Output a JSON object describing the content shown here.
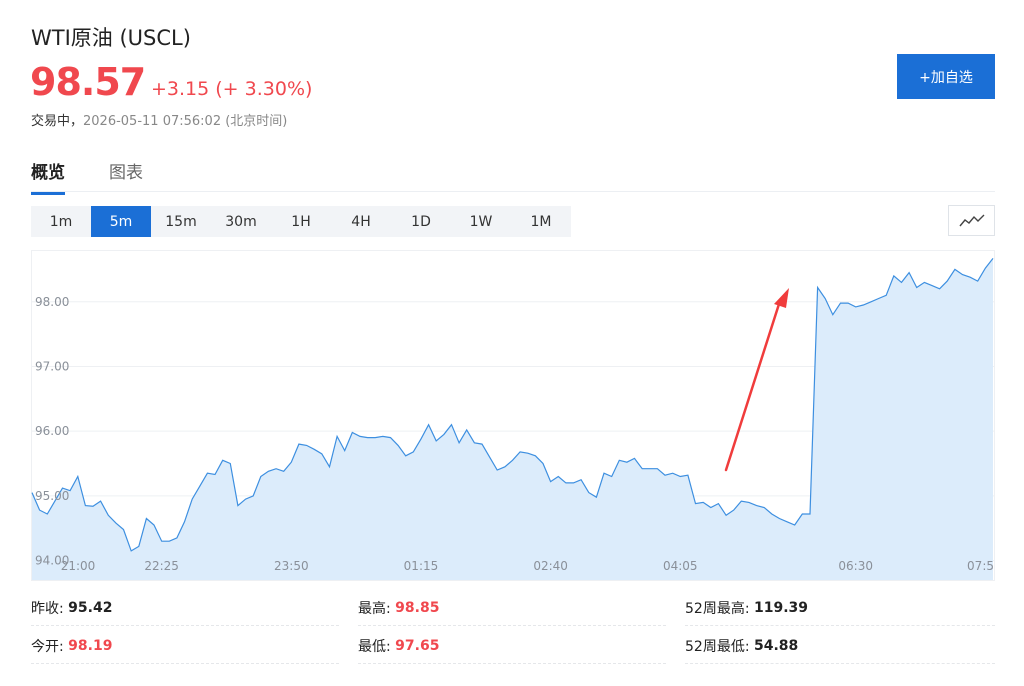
{
  "header": {
    "title": "WTI原油 (USCL)",
    "price": "98.57",
    "change": "+3.15 (+ 3.30%)",
    "status_prefix": "交易中，",
    "timestamp": "2026-05-11 07:56:02 (北京时间)",
    "add_button": "+加自选"
  },
  "tabs": [
    {
      "label": "概览",
      "active": true
    },
    {
      "label": "图表",
      "active": false
    }
  ],
  "ranges": [
    {
      "label": "1m",
      "active": false
    },
    {
      "label": "5m",
      "active": true
    },
    {
      "label": "15m",
      "active": false
    },
    {
      "label": "30m",
      "active": false
    },
    {
      "label": "1H",
      "active": false
    },
    {
      "label": "4H",
      "active": false
    },
    {
      "label": "1D",
      "active": false
    },
    {
      "label": "1W",
      "active": false
    },
    {
      "label": "1M",
      "active": false
    }
  ],
  "chart_data": {
    "type": "area",
    "ylim": [
      93.7,
      98.8
    ],
    "yticks": [
      94.0,
      95.0,
      96.0,
      97.0,
      98.0
    ],
    "ytick_labels": [
      "94.00",
      "95.00",
      "96.00",
      "97.00",
      "98.00"
    ],
    "xtick_labels": [
      "21:00",
      "22:25",
      "23:50",
      "01:15",
      "02:40",
      "04:05",
      "06:30",
      "07:5"
    ],
    "xtick_positions": [
      0,
      17,
      34,
      51,
      68,
      85,
      108,
      123
    ],
    "values": [
      95.05,
      94.78,
      94.72,
      94.92,
      95.12,
      95.08,
      95.3,
      94.85,
      94.84,
      94.92,
      94.7,
      94.58,
      94.48,
      94.15,
      94.22,
      94.65,
      94.55,
      94.3,
      94.3,
      94.35,
      94.6,
      94.95,
      95.15,
      95.35,
      95.33,
      95.55,
      95.5,
      94.85,
      94.95,
      95.0,
      95.3,
      95.38,
      95.42,
      95.38,
      95.52,
      95.8,
      95.78,
      95.72,
      95.65,
      95.45,
      95.92,
      95.7,
      95.98,
      95.92,
      95.9,
      95.9,
      95.92,
      95.9,
      95.78,
      95.62,
      95.68,
      95.88,
      96.1,
      95.85,
      95.95,
      96.1,
      95.82,
      96.02,
      95.82,
      95.8,
      95.6,
      95.4,
      95.45,
      95.55,
      95.68,
      95.66,
      95.62,
      95.5,
      95.22,
      95.3,
      95.2,
      95.2,
      95.25,
      95.05,
      94.98,
      95.35,
      95.3,
      95.55,
      95.52,
      95.58,
      95.42,
      95.42,
      95.42,
      95.32,
      95.35,
      95.3,
      95.32,
      94.88,
      94.9,
      94.82,
      94.88,
      94.7,
      94.78,
      94.92,
      94.9,
      94.85,
      94.82,
      94.72,
      94.65,
      94.6,
      94.55,
      94.72,
      94.72,
      98.22,
      98.05,
      97.8,
      97.98,
      97.98,
      97.92,
      97.95,
      98.0,
      98.05,
      98.1,
      98.4,
      98.3,
      98.45,
      98.22,
      98.3,
      98.25,
      98.2,
      98.32,
      98.5,
      98.42,
      98.38,
      98.32,
      98.52,
      98.67
    ]
  },
  "annotation": {
    "arrow_color": "#f03c3c"
  },
  "stats": [
    {
      "label": "昨收:",
      "value": "95.42",
      "red": false
    },
    {
      "label": "最高:",
      "value": "98.85",
      "red": true
    },
    {
      "label": "52周最高:",
      "value": "119.39",
      "red": false
    },
    {
      "label": "今开:",
      "value": "98.19",
      "red": true
    },
    {
      "label": "最低:",
      "value": "97.65",
      "red": true
    },
    {
      "label": "52周最低:",
      "value": "54.88",
      "red": false
    }
  ]
}
